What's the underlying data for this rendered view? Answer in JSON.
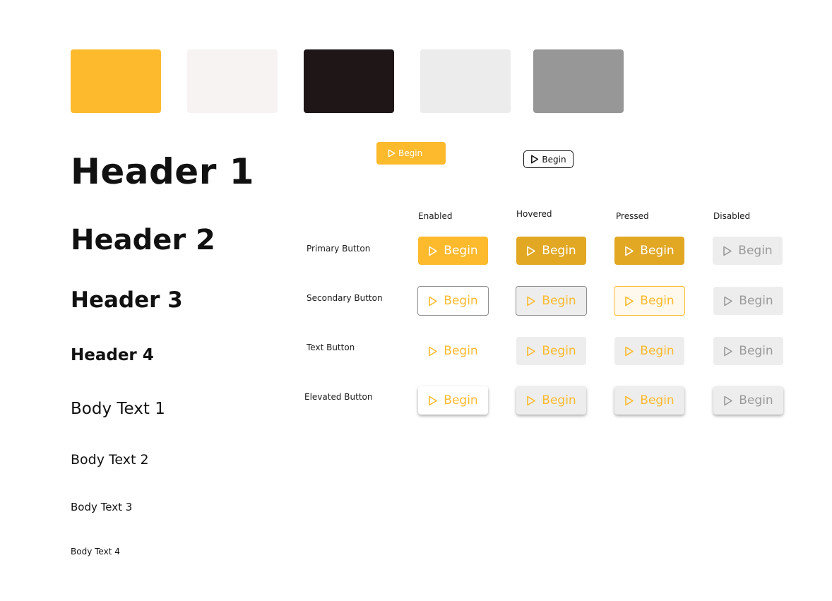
{
  "palette": [
    {
      "name": "primary-yellow",
      "color": "#FDBA2C"
    },
    {
      "name": "off-white",
      "color": "#F7F3F2"
    },
    {
      "name": "near-black",
      "color": "#1E1617"
    },
    {
      "name": "light-gray",
      "color": "#ECECEC"
    },
    {
      "name": "mid-gray",
      "color": "#979797"
    }
  ],
  "typography": {
    "header1": "Header 1",
    "header2": "Header 2",
    "header3": "Header 3",
    "header4": "Header 4",
    "body1": "Body Text 1",
    "body2": "Body Text 2",
    "body3": "Body Text 3",
    "body4": "Body Text 4"
  },
  "samples": {
    "primary_label": "Begin",
    "outline_label": "Begin"
  },
  "states": {
    "enabled": "Enabled",
    "hovered": "Hovered",
    "pressed": "Pressed",
    "disabled": "Disabled"
  },
  "rows": {
    "primary": "Primary Button",
    "secondary": "Secondary Button",
    "text": "Text Button",
    "elevated": "Elevated Button"
  },
  "button_label": "Begin",
  "icons": {
    "play": "play-icon"
  }
}
